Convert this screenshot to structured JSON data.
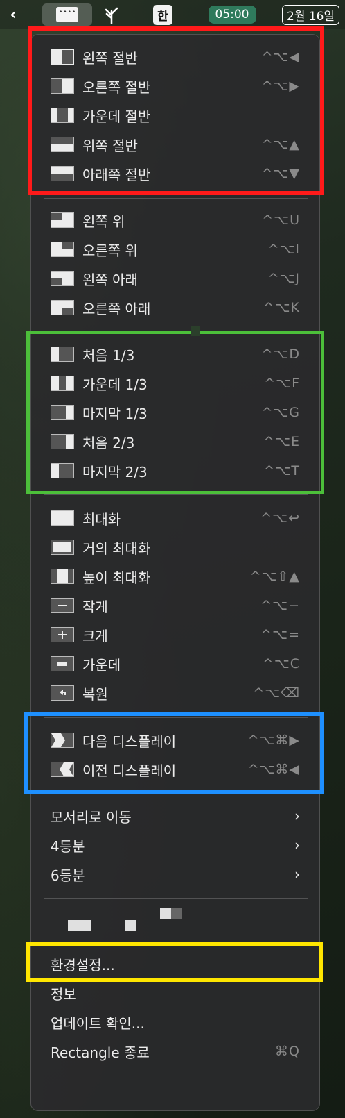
{
  "menubar": {
    "back_chevron": "‹",
    "rectangle_icon": "rectangle-menu-icon",
    "tree_icon": "tree-icon",
    "input_source": "한",
    "time": "05:00",
    "date": "2월 16일"
  },
  "menu": {
    "halves": [
      {
        "label": "왼쪽 절반",
        "shortcut": "^⌥◀",
        "icon": "left-half-icon"
      },
      {
        "label": "오른쪽 절반",
        "shortcut": "^⌥▶",
        "icon": "right-half-icon"
      },
      {
        "label": "가운데 절반",
        "shortcut": "",
        "icon": "center-half-icon"
      },
      {
        "label": "위쪽 절반",
        "shortcut": "^⌥▲",
        "icon": "top-half-icon"
      },
      {
        "label": "아래쪽 절반",
        "shortcut": "^⌥▼",
        "icon": "bottom-half-icon"
      }
    ],
    "quarters": [
      {
        "label": "왼쪽 위",
        "shortcut": "^⌥U",
        "icon": "top-left-icon"
      },
      {
        "label": "오른쪽 위",
        "shortcut": "^⌥I",
        "icon": "top-right-icon"
      },
      {
        "label": "왼쪽 아래",
        "shortcut": "^⌥J",
        "icon": "bottom-left-icon"
      },
      {
        "label": "오른쪽 아래",
        "shortcut": "^⌥K",
        "icon": "bottom-right-icon"
      }
    ],
    "thirds": [
      {
        "label": "처음 1/3",
        "shortcut": "^⌥D",
        "icon": "first-third-icon"
      },
      {
        "label": "가운데 1/3",
        "shortcut": "^⌥F",
        "icon": "center-third-icon"
      },
      {
        "label": "마지막 1/3",
        "shortcut": "^⌥G",
        "icon": "last-third-icon"
      },
      {
        "label": "처음 2/3",
        "shortcut": "^⌥E",
        "icon": "first-two-thirds-icon"
      },
      {
        "label": "마지막 2/3",
        "shortcut": "^⌥T",
        "icon": "last-two-thirds-icon"
      }
    ],
    "sizing": [
      {
        "label": "최대화",
        "shortcut": "^⌥↩",
        "icon": "maximize-icon"
      },
      {
        "label": "거의 최대화",
        "shortcut": "",
        "icon": "almost-maximize-icon"
      },
      {
        "label": "높이 최대화",
        "shortcut": "^⌥⇧▲",
        "icon": "maximize-height-icon"
      },
      {
        "label": "작게",
        "shortcut": "^⌥−",
        "icon": "smaller-icon"
      },
      {
        "label": "크게",
        "shortcut": "^⌥=",
        "icon": "larger-icon"
      },
      {
        "label": "가운데",
        "shortcut": "^⌥C",
        "icon": "center-icon"
      },
      {
        "label": "복원",
        "shortcut": "^⌥⌫",
        "icon": "restore-icon"
      }
    ],
    "displays": [
      {
        "label": "다음 디스플레이",
        "shortcut": "^⌥⌘▶",
        "icon": "next-display-icon"
      },
      {
        "label": "이전 디스플레이",
        "shortcut": "^⌥⌘◀",
        "icon": "previous-display-icon"
      }
    ],
    "submenus": [
      {
        "label": "모서리로 이동",
        "arrow": "›"
      },
      {
        "label": "4등분",
        "arrow": "›"
      },
      {
        "label": "6등분",
        "arrow": "›"
      }
    ],
    "footer": [
      {
        "label": "환경설정...",
        "shortcut": ""
      },
      {
        "label": "정보",
        "shortcut": ""
      },
      {
        "label": "업데이트 확인...",
        "shortcut": ""
      },
      {
        "label": "Rectangle 종료",
        "shortcut": "⌘Q"
      }
    ]
  },
  "colors": {
    "highlight_red": "#ff1a1a",
    "highlight_green": "#4cbf3a",
    "highlight_blue": "#1e90ff",
    "highlight_yellow": "#ffe600"
  }
}
